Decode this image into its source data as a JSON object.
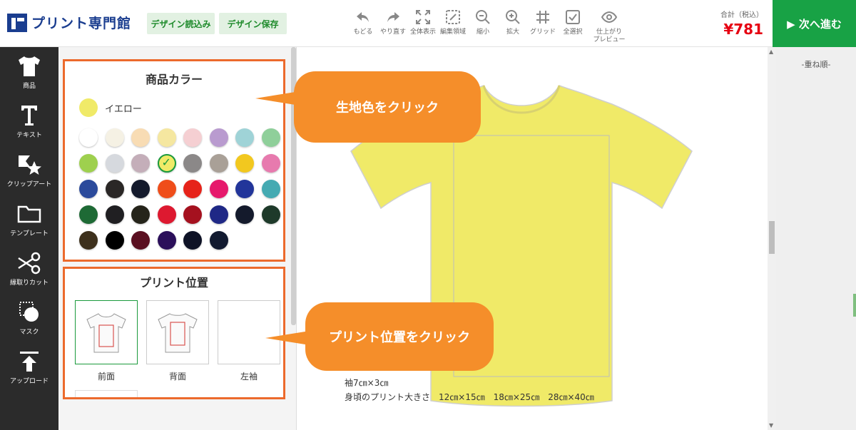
{
  "header": {
    "logo": "プリント専門館",
    "design_load": "デザイン読込み",
    "design_save": "デザイン保存",
    "tools": [
      {
        "icon": "undo-icon",
        "label": "もどる"
      },
      {
        "icon": "redo-icon",
        "label": "やり直す"
      },
      {
        "icon": "fullscreen-icon",
        "label": "全体表示"
      },
      {
        "icon": "edit-area-icon",
        "label": "編集領域"
      },
      {
        "icon": "zoom-out-icon",
        "label": "縮小"
      },
      {
        "icon": "zoom-in-icon",
        "label": "拡大"
      },
      {
        "icon": "grid-icon",
        "label": "グリッド"
      },
      {
        "icon": "select-all-icon",
        "label": "全選択"
      },
      {
        "icon": "eye-icon",
        "label": "仕上がり\nプレビュー"
      }
    ],
    "total_label": "合計（税込）",
    "total_price": "¥781",
    "next_button": "▶ 次へ進む"
  },
  "sidebar": {
    "items": [
      {
        "icon": "tshirt-icon",
        "label": "商品"
      },
      {
        "icon": "text-icon",
        "label": "テキスト"
      },
      {
        "icon": "clipart-icon",
        "label": "クリップアート"
      },
      {
        "icon": "folder-icon",
        "label": "テンプレート"
      },
      {
        "icon": "scissors-icon",
        "label": "縁取りカット"
      },
      {
        "icon": "mask-icon",
        "label": "マスク"
      },
      {
        "icon": "upload-icon",
        "label": "アップロード"
      }
    ]
  },
  "color_section": {
    "title": "商品カラー",
    "selected_name": "イエロー",
    "selected_color": "#f0ea68",
    "swatches": [
      "#ffffff",
      "#f5f1e4",
      "#f8dcb4",
      "#f5e7a0",
      "#f5cfd2",
      "#b99bcf",
      "#9fd3d7",
      "#8fcf9a",
      "#9ed04e",
      "#d6d9de",
      "#c4aeb9",
      "#f0ea68",
      "#8b8888",
      "#a9a097",
      "#f2c81f",
      "#e77aae",
      "#2b4a9b",
      "#2a2726",
      "#141a2c",
      "#ef4d1a",
      "#e6231a",
      "#e6196c",
      "#22359a",
      "#45aab2",
      "#1e6a35",
      "#201f22",
      "#25241a",
      "#dd1930",
      "#a5111f",
      "#1f2886",
      "#141a2c",
      "#1e3a2a",
      "#3d301c",
      "#000000",
      "#5a0f20",
      "#2b0f5a",
      "#0e1226",
      "#121a30"
    ],
    "selected_index": 11
  },
  "position_section": {
    "title": "プリント位置",
    "positions": [
      "前面",
      "背面",
      "左袖"
    ]
  },
  "callouts": {
    "fabric": "生地色をクリック",
    "position": "プリント位置をクリック"
  },
  "canvas": {
    "sleeve_size": "袖7㎝×3㎝",
    "body_size": "身頃のプリント大きさ　12㎝×15㎝　18㎝×25㎝　28㎝×40㎝",
    "shirt_color": "#f0ea68"
  },
  "right_panel": {
    "order_label": "-重ね順-"
  }
}
